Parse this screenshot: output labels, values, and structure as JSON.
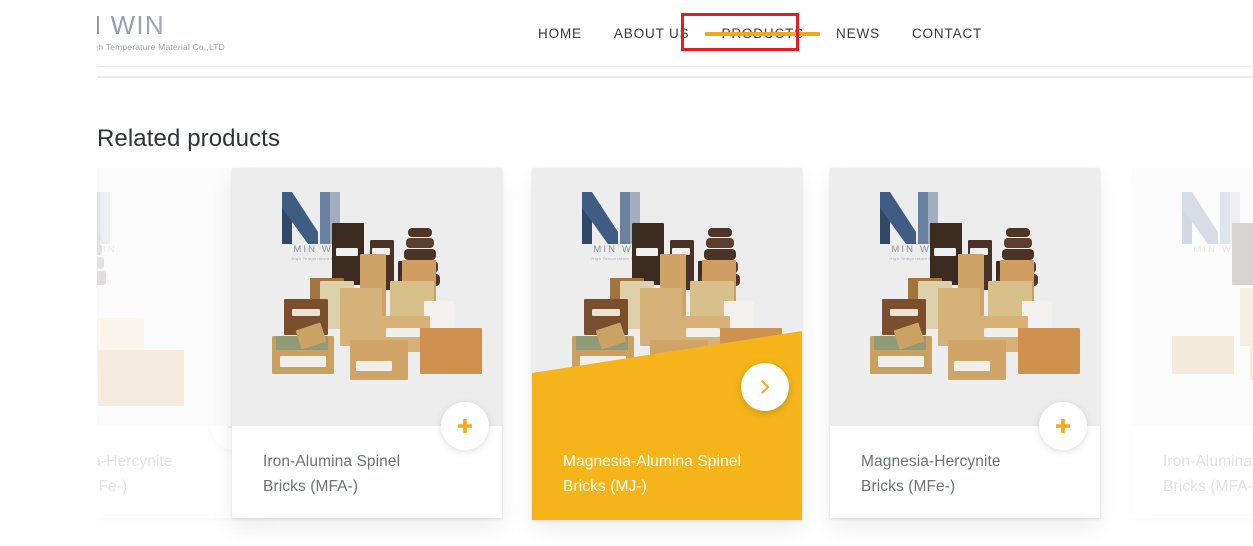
{
  "header": {
    "brand": {
      "name": "MIN WIN",
      "tagline": "High Temperature Material Co.,LTD",
      "logo_icon": "minwin-m-logo-icon"
    },
    "nav": [
      {
        "label": "HOME",
        "active": false
      },
      {
        "label": "ABOUT US",
        "active": false
      },
      {
        "label": "PRODUCTS",
        "active": true
      },
      {
        "label": "NEWS",
        "active": false
      },
      {
        "label": "CONTACT",
        "active": false
      }
    ],
    "active_underline_color": "#f0a81e"
  },
  "annotation": {
    "target": "PRODUCTS",
    "box_color": "#e02020"
  },
  "section": {
    "title": "Related products"
  },
  "colors": {
    "accent_amber": "#f5b51a",
    "plus_icon": "#f5a91c",
    "card_bg": "#ffffff",
    "thumb_bg": "#ececed",
    "title_text": "#6c7278",
    "heading_text": "#2f3337"
  },
  "carousel": {
    "next_icon": "chevron-right-icon",
    "expand_icon": "plus-icon",
    "cards": [
      {
        "title": "Magnesia-Hercynite\nBricks (MFe-)",
        "visible_title": "cynite",
        "state": "faded-partial",
        "watermark": "MIN WIN"
      },
      {
        "title": "Iron-Alumina Spinel\nBricks (MFA-)",
        "state": "normal",
        "watermark": "MIN WIN"
      },
      {
        "title": "Magnesia-Alumina Spinel\nBricks (MJ-)",
        "state": "active-highlighted",
        "watermark": "MIN WIN"
      },
      {
        "title": "Magnesia-Hercynite\nBricks (MFe-)",
        "state": "normal",
        "watermark": "MIN WIN"
      },
      {
        "title": "Iron-Alumina Spinel\nBricks (MFA-)",
        "visible_title": "Iron-Alu\nBricks (N",
        "state": "faded-partial",
        "watermark": "MIN WIN"
      }
    ]
  }
}
